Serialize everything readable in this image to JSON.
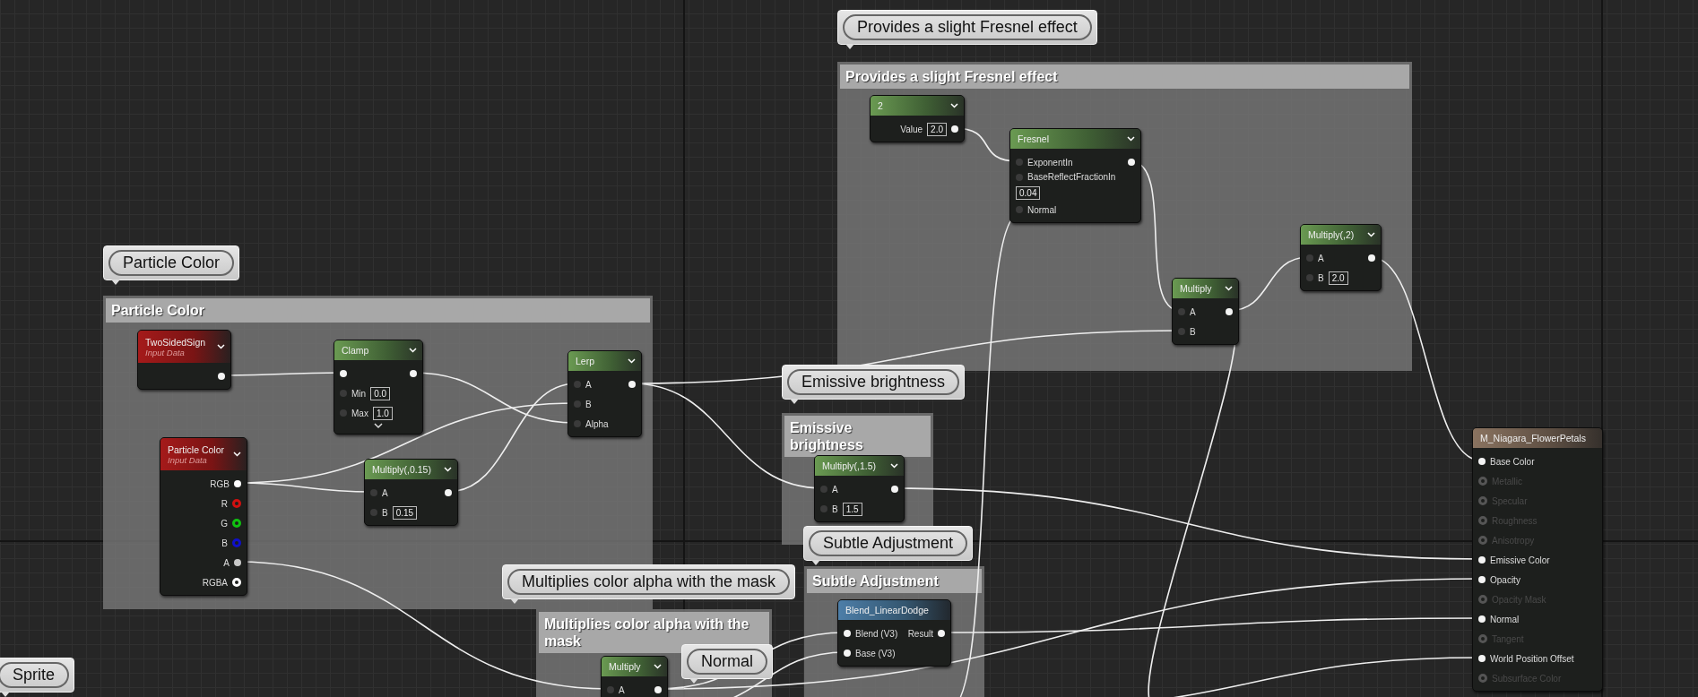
{
  "frames": [
    {
      "title": "Provides a slight Fresnel effect"
    },
    {
      "title": "Particle Color"
    },
    {
      "title": "Emissive brightness"
    },
    {
      "title": "Subtle Adjustment"
    },
    {
      "title": "Multiplies color alpha with the mask"
    }
  ],
  "nodes": [
    {
      "kind": "math",
      "title": "2",
      "outputs": [
        {
          "label": "Value",
          "value": "2.0",
          "connected": true
        }
      ]
    },
    {
      "kind": "math",
      "title": "Fresnel",
      "inputs": [
        {
          "label": "ExponentIn"
        },
        {
          "label": "BaseReflectFractionIn",
          "value": "0.04"
        },
        {
          "label": "Normal"
        }
      ],
      "outputs": [
        {
          "connected": true
        }
      ]
    },
    {
      "kind": "math",
      "title": "Multiply",
      "inputs": [
        {
          "label": "A"
        },
        {
          "label": "B"
        }
      ],
      "outputs": [
        {
          "connected": true
        }
      ]
    },
    {
      "kind": "math",
      "title": "Multiply(,2)",
      "inputs": [
        {
          "label": "A"
        },
        {
          "label": "B",
          "value": "2.0"
        }
      ],
      "outputs": [
        {
          "connected": true
        }
      ]
    },
    {
      "kind": "input",
      "title": "TwoSidedSign",
      "subtitle": "Input Data",
      "outputs": [
        {
          "connected": true
        }
      ]
    },
    {
      "kind": "math",
      "title": "Clamp",
      "advanced_pins": true,
      "inputs": [
        {
          "connected": true
        },
        {
          "label": "Min",
          "value": "0.0"
        },
        {
          "label": "Max",
          "value": "1.0"
        }
      ],
      "outputs": [
        {
          "connected": true
        }
      ]
    },
    {
      "kind": "math",
      "title": "Lerp",
      "inputs": [
        {
          "label": "A"
        },
        {
          "label": "B"
        },
        {
          "label": "Alpha"
        }
      ],
      "outputs": [
        {
          "connected": true
        }
      ]
    },
    {
      "kind": "input",
      "title": "Particle Color",
      "subtitle": "Input Data",
      "outputs": [
        {
          "label": "RGB",
          "connected": true,
          "color": "#ffffff"
        },
        {
          "label": "R",
          "connected": false,
          "color": "#d01010"
        },
        {
          "label": "G",
          "connected": false,
          "color": "#10c010"
        },
        {
          "label": "B",
          "connected": false,
          "color": "#1010c8"
        },
        {
          "label": "A",
          "connected": true,
          "color": "#c8c8c8"
        },
        {
          "label": "RGBA",
          "connected": false,
          "color": "#ffffff"
        }
      ]
    },
    {
      "kind": "math",
      "title": "Multiply(,0.15)",
      "inputs": [
        {
          "label": "A"
        },
        {
          "label": "B",
          "value": "0.15"
        }
      ],
      "outputs": [
        {
          "connected": true
        }
      ]
    },
    {
      "kind": "math",
      "title": "Multiply(,1.5)",
      "inputs": [
        {
          "label": "A"
        },
        {
          "label": "B",
          "value": "1.5"
        }
      ],
      "outputs": [
        {
          "connected": true
        }
      ]
    },
    {
      "kind": "function",
      "title": "Blend_LinearDodge",
      "inputs": [
        {
          "label": "Blend (V3)",
          "connected": true
        },
        {
          "label": "Base (V3)",
          "connected": true
        }
      ],
      "outputs": [
        {
          "label": "Result",
          "connected": true
        }
      ]
    },
    {
      "kind": "math",
      "title": "Multiply",
      "inputs": [
        {
          "label": "A"
        }
      ],
      "outputs": [
        {
          "connected": true
        }
      ]
    },
    {
      "kind": "result",
      "title": "M_Niagara_FlowerPetals",
      "inputs": [
        {
          "label": "Base Color",
          "connected": true
        },
        {
          "label": "Metallic",
          "connected": false
        },
        {
          "label": "Specular",
          "connected": false
        },
        {
          "label": "Roughness",
          "connected": false
        },
        {
          "label": "Anisotropy",
          "connected": false
        },
        {
          "label": "Emissive Color",
          "connected": true
        },
        {
          "label": "Opacity",
          "connected": true
        },
        {
          "label": "Opacity Mask",
          "connected": false
        },
        {
          "label": "Normal",
          "connected": true
        },
        {
          "label": "Tangent",
          "connected": false
        },
        {
          "label": "World Position Offset",
          "connected": true
        },
        {
          "label": "Subsurface Color",
          "connected": false
        }
      ]
    }
  ],
  "bubbles": [
    {
      "text": "Provides a slight Fresnel effect"
    },
    {
      "text": "Particle Color"
    },
    {
      "text": "Emissive brightness"
    },
    {
      "text": "Subtle Adjustment"
    },
    {
      "text": "Multiplies color alpha with the mask"
    },
    {
      "text": "Normal"
    },
    {
      "text": "Sprite"
    }
  ]
}
